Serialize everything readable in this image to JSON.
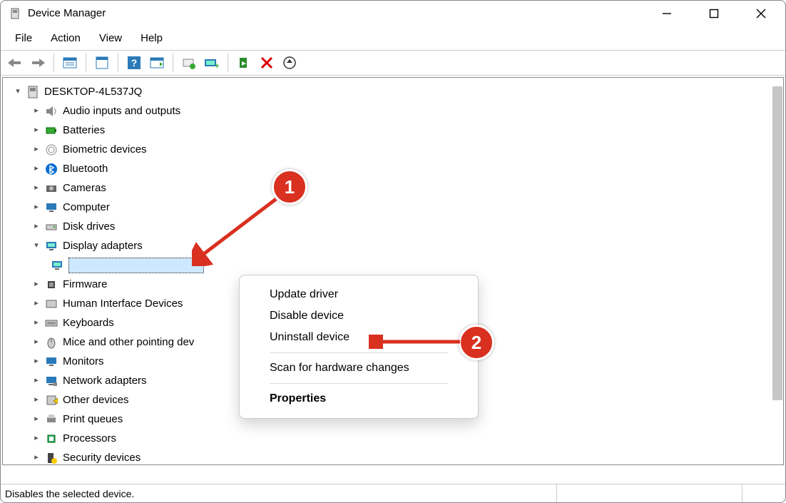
{
  "window": {
    "title": "Device Manager"
  },
  "menu": {
    "file": "File",
    "action": "Action",
    "view": "View",
    "help": "Help"
  },
  "tree": {
    "root": "DESKTOP-4L537JQ",
    "items": [
      {
        "label": "Audio inputs and outputs",
        "expanded": false
      },
      {
        "label": "Batteries",
        "expanded": false
      },
      {
        "label": "Biometric devices",
        "expanded": false
      },
      {
        "label": "Bluetooth",
        "expanded": false
      },
      {
        "label": "Cameras",
        "expanded": false
      },
      {
        "label": "Computer",
        "expanded": false
      },
      {
        "label": "Disk drives",
        "expanded": false
      },
      {
        "label": "Display adapters",
        "expanded": true,
        "children": [
          {
            "label": ""
          }
        ]
      },
      {
        "label": "Firmware",
        "expanded": false
      },
      {
        "label": "Human Interface Devices",
        "expanded": false
      },
      {
        "label": "Keyboards",
        "expanded": false
      },
      {
        "label": "Mice and other pointing dev",
        "expanded": false
      },
      {
        "label": "Monitors",
        "expanded": false
      },
      {
        "label": "Network adapters",
        "expanded": false
      },
      {
        "label": "Other devices",
        "expanded": false
      },
      {
        "label": "Print queues",
        "expanded": false
      },
      {
        "label": "Processors",
        "expanded": false
      },
      {
        "label": "Security devices",
        "expanded": false
      }
    ]
  },
  "context_menu": {
    "update": "Update driver",
    "disable": "Disable device",
    "uninstall": "Uninstall device",
    "scan": "Scan for hardware changes",
    "properties": "Properties"
  },
  "statusbar": {
    "text": "Disables the selected device."
  },
  "annotations": {
    "badge1": "1",
    "badge2": "2"
  }
}
